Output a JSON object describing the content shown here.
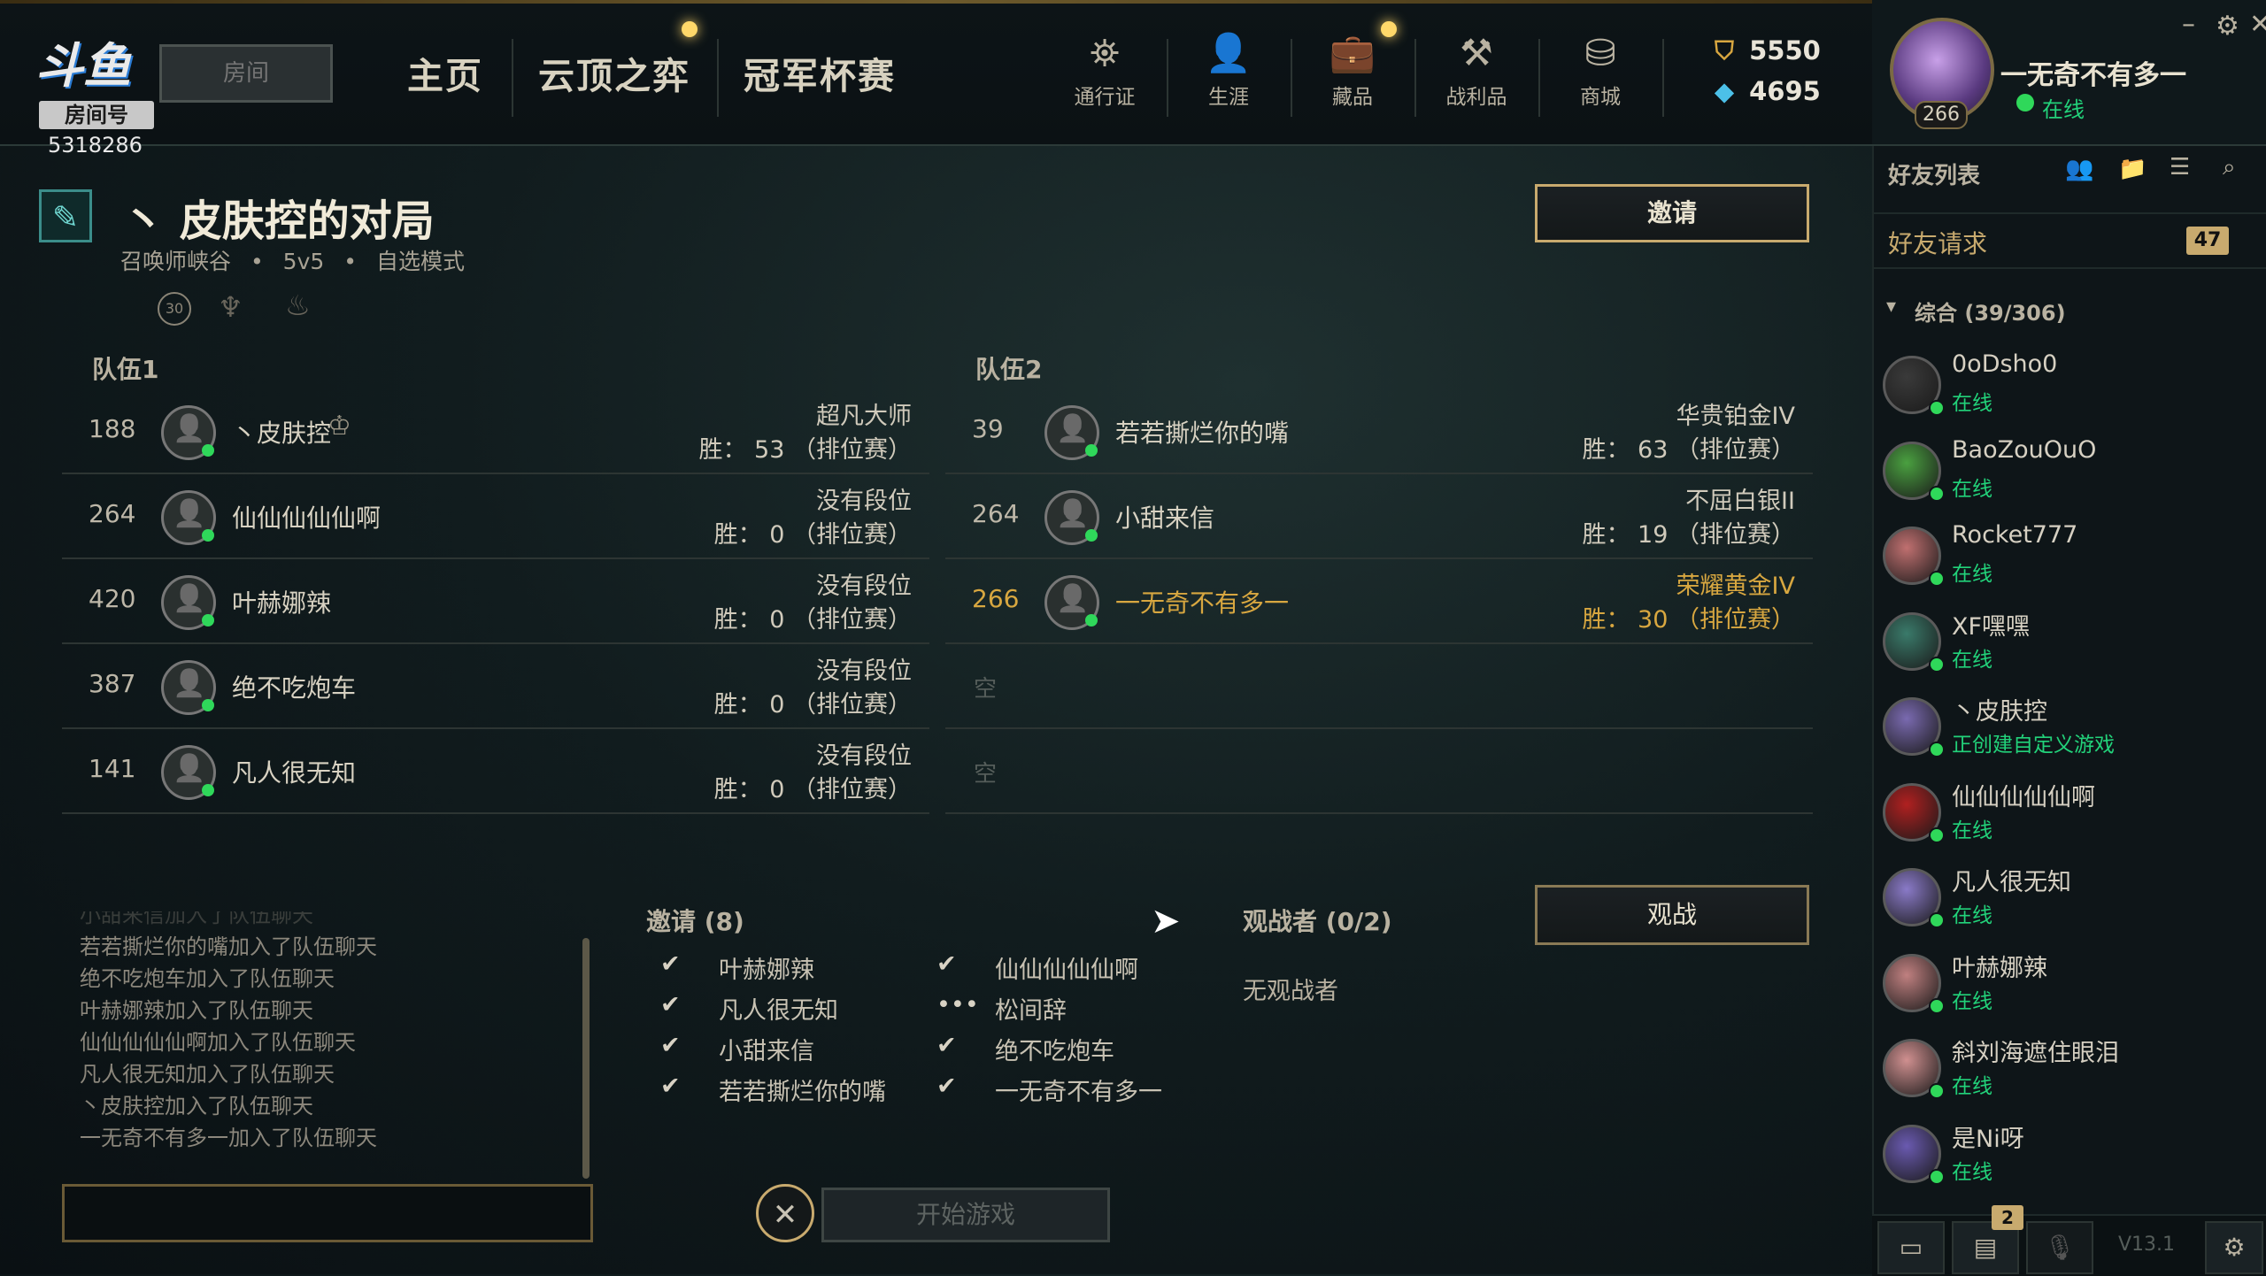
{
  "brand": {
    "logo_text": "斗鱼",
    "room_label": "房间号",
    "room_number": "5318286",
    "room_input_placeholder": "房间"
  },
  "nav": {
    "home": "主页",
    "tft": "云顶之弈",
    "clash": "冠军杯赛"
  },
  "top_icons": [
    {
      "label": "通行证",
      "icon": "pass-icon"
    },
    {
      "label": "生涯",
      "icon": "profile-icon"
    },
    {
      "label": "藏品",
      "icon": "collection-icon"
    },
    {
      "label": "战利品",
      "icon": "loot-icon"
    },
    {
      "label": "商城",
      "icon": "store-icon"
    }
  ],
  "currency": {
    "be": "5550",
    "rp": "4695"
  },
  "profile": {
    "name": "一无奇不有多一",
    "level": "266",
    "status": "在线"
  },
  "lobby": {
    "title": "皮肤控的对局",
    "title_prefix": "丶",
    "map": "召唤师峡谷",
    "size": "5v5",
    "mode": "自选模式",
    "timer_badge": "30",
    "invite_button": "邀请",
    "spectate_button": "观战",
    "start_button": "开始游戏"
  },
  "teams": {
    "team1_label": "队伍1",
    "team2_label": "队伍2",
    "team1": [
      {
        "level": "188",
        "name": "丶皮肤控",
        "rank": "超凡大师",
        "wins": "胜： 53 （排位赛）"
      },
      {
        "level": "264",
        "name": "仙仙仙仙仙啊",
        "rank": "没有段位",
        "wins": "胜： 0 （排位赛）"
      },
      {
        "level": "420",
        "name": "叶赫娜辣",
        "rank": "没有段位",
        "wins": "胜： 0 （排位赛）"
      },
      {
        "level": "387",
        "name": "绝不吃炮车",
        "rank": "没有段位",
        "wins": "胜： 0 （排位赛）"
      },
      {
        "level": "141",
        "name": "凡人很无知",
        "rank": "没有段位",
        "wins": "胜： 0 （排位赛）"
      }
    ],
    "team2": [
      {
        "level": "39",
        "name": "若若撕烂你的嘴",
        "rank": "华贵铂金IV",
        "wins": "胜： 63 （排位赛）"
      },
      {
        "level": "264",
        "name": "小甜来信",
        "rank": "不屈白银II",
        "wins": "胜： 19 （排位赛）"
      },
      {
        "level": "266",
        "name": "一无奇不有多一",
        "rank": "荣耀黄金IV",
        "wins": "胜： 30 （排位赛）"
      }
    ],
    "empty_slot": "空"
  },
  "invites": {
    "header": "邀请 (8)",
    "col1": [
      {
        "mark": "✔",
        "name": "叶赫娜辣"
      },
      {
        "mark": "✔",
        "name": "凡人很无知"
      },
      {
        "mark": "✔",
        "name": "小甜来信"
      },
      {
        "mark": "✔",
        "name": "若若撕烂你的嘴"
      }
    ],
    "col2": [
      {
        "mark": "✔",
        "name": "仙仙仙仙仙啊"
      },
      {
        "mark": "•••",
        "name": "松间辞"
      },
      {
        "mark": "✔",
        "name": "绝不吃炮车"
      },
      {
        "mark": "✔",
        "name": "一无奇不有多一"
      }
    ]
  },
  "spectators": {
    "header": "观战者 (0/2)",
    "empty": "无观战者"
  },
  "chat": {
    "lines": [
      "小甜来信加入了队伍聊天",
      "若若撕烂你的嘴加入了队伍聊天",
      "绝不吃炮车加入了队伍聊天",
      "叶赫娜辣加入了队伍聊天",
      "仙仙仙仙仙啊加入了队伍聊天",
      "凡人很无知加入了队伍聊天",
      "丶皮肤控加入了队伍聊天",
      "一无奇不有多一加入了队伍聊天"
    ]
  },
  "social": {
    "header": "好友列表",
    "requests_label": "好友请求",
    "requests_count": "47",
    "group_label": "综合 (39/306)",
    "friends": [
      {
        "name": "0oDsho0",
        "status": "在线"
      },
      {
        "name": "BaoZouOuO",
        "status": "在线"
      },
      {
        "name": "Rocket777",
        "status": "在线"
      },
      {
        "name": "XF嘿嘿",
        "status": "在线"
      },
      {
        "name": "丶皮肤控",
        "status": "正创建自定义游戏"
      },
      {
        "name": "仙仙仙仙仙啊",
        "status": "在线"
      },
      {
        "name": "凡人很无知",
        "status": "在线"
      },
      {
        "name": "叶赫娜辣",
        "status": "在线"
      },
      {
        "name": "斜刘海遮住眼泪",
        "status": "在线"
      },
      {
        "name": "是Ni呀",
        "status": "在线"
      }
    ],
    "version": "V13.1",
    "notif_badge": "2"
  },
  "colors": {
    "accent_gold": "#c8aa6e",
    "online_green": "#22d27a",
    "highlight_gold": "#d8a740"
  }
}
